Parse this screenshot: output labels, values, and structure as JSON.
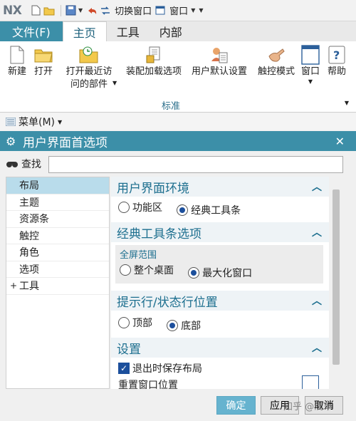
{
  "qat": {
    "logo": "NX",
    "switch_window": "切换窗口",
    "window": "窗口"
  },
  "ribbon_tabs": [
    {
      "label": "文件(F)"
    },
    {
      "label": "主页"
    },
    {
      "label": "工具"
    },
    {
      "label": "内部"
    }
  ],
  "ribbon": {
    "buttons": {
      "new": "新建",
      "open": "打开",
      "open_recent": "打开最近访",
      "open_recent_2": "问的部件",
      "assembly_load": "装配加载选项",
      "user_defaults": "用户默认设置",
      "touch_mode": "触控模式",
      "window": "窗口",
      "help": "帮助"
    },
    "group_label": "标准"
  },
  "menubar": {
    "label": "菜单(M)"
  },
  "dialog": {
    "title": "用户界面首选项",
    "search_label": "查找",
    "search_value": "",
    "tree": [
      {
        "label": "布局",
        "selected": true
      },
      {
        "label": "主题"
      },
      {
        "label": "资源条"
      },
      {
        "label": "触控"
      },
      {
        "label": "角色"
      },
      {
        "label": "选项"
      },
      {
        "label": "工具",
        "expandable": true
      }
    ],
    "sections": {
      "env": {
        "title": "用户界面环境",
        "options": [
          "功能区",
          "经典工具条"
        ],
        "selected": "经典工具条"
      },
      "classic": {
        "title": "经典工具条选项",
        "group": "全屏范围",
        "options": [
          "整个桌面",
          "最大化窗口"
        ],
        "selected": "最大化窗口"
      },
      "prompt": {
        "title": "提示行/状态行位置",
        "options": [
          "顶部",
          "底部"
        ],
        "selected": "底部"
      },
      "settings": {
        "title": "设置",
        "save_on_exit": "退出时保存布局",
        "reset_window": "重置窗口位置"
      }
    },
    "buttons": {
      "ok": "确定",
      "apply": "应用",
      "cancel": "取消"
    }
  },
  "watermark": "知乎 @浅草"
}
